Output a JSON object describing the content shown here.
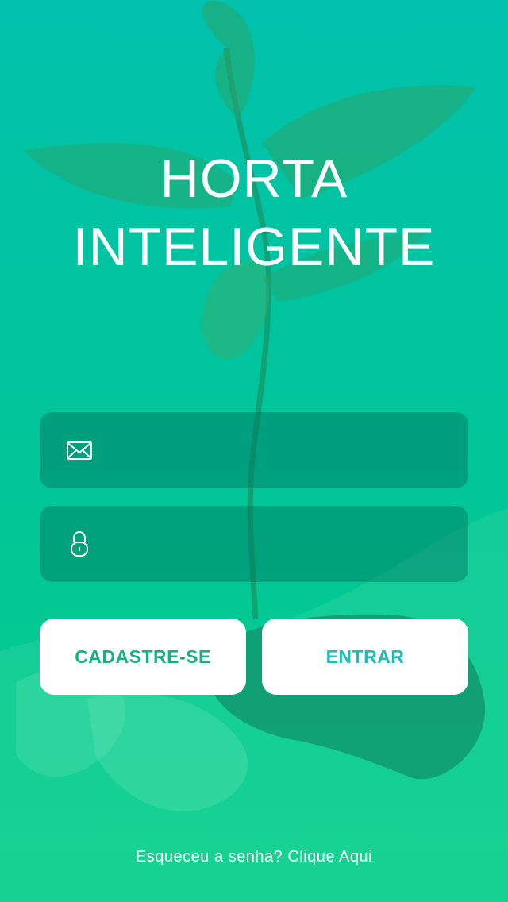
{
  "app": {
    "title_line1": "HORTA",
    "title_line2": "INTELIGENTE"
  },
  "login_form": {
    "email_icon": "envelope-icon",
    "email_value": "",
    "password_icon": "lock-icon",
    "password_value": ""
  },
  "actions": {
    "register_label": "CADASTRE-SE",
    "login_label": "ENTRAR"
  },
  "forgot": {
    "prompt": "Esqueceu a senha?",
    "link": "Clique Aqui"
  },
  "colors": {
    "background_top": "#00c2ad",
    "background_bottom": "#04d08a",
    "register_text": "#13b27f",
    "login_text": "#1bbfb8"
  }
}
